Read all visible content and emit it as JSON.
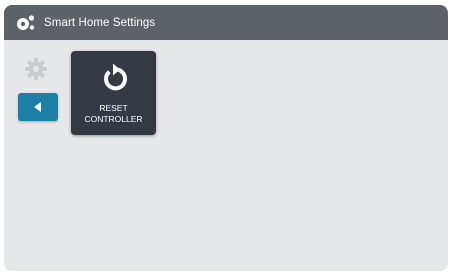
{
  "header": {
    "title": "Smart Home Settings",
    "icon": "smart-home-icon"
  },
  "sidebar": {
    "settings_icon": "gear-icon",
    "back_icon": "back-arrow-icon"
  },
  "tiles": [
    {
      "icon": "reset-icon",
      "label_line1": "RESET",
      "label_line2": "CONTROLLER"
    }
  ],
  "colors": {
    "title_bar": "#5d6168",
    "background": "#e6e7e9",
    "accent": "#1c7fa6",
    "tile": "#333a43"
  }
}
